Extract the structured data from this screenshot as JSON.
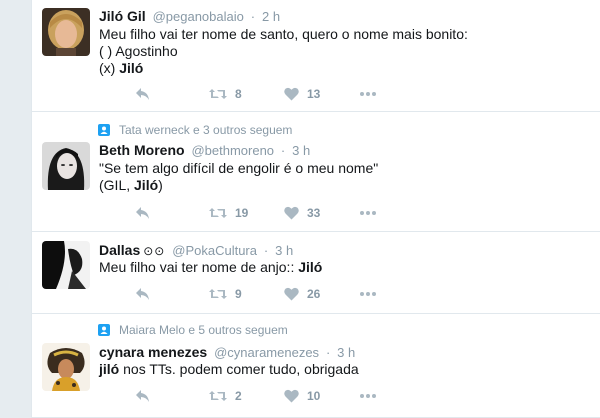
{
  "tweets": [
    {
      "context": "",
      "name": "Jiló Gil",
      "handle": "@peganobalaio",
      "time": "2 h",
      "text_parts": {
        "l1": "Meu filho vai ter nome de santo, quero o nome mais bonito:",
        "l2": "( ) Agostinho",
        "l3a": "(x) ",
        "l3b": "Jiló"
      },
      "retweets": "8",
      "likes": "13"
    },
    {
      "context": "Tata werneck e 3 outros seguem",
      "name": "Beth Moreno",
      "handle": "@bethmoreno",
      "time": "3 h",
      "text_parts": {
        "l1": "\"Se tem algo difícil de engolir é o meu nome\"",
        "l2a": "(GIL, ",
        "l2b": "Jiló",
        "l2c": ")"
      },
      "retweets": "19",
      "likes": "33"
    },
    {
      "context": "",
      "name": "Dallas",
      "badge": "⊙⊙",
      "handle": "@PokaCultura",
      "time": "3 h",
      "text_parts": {
        "l1a": "Meu filho vai ter nome de anjo:: ",
        "l1b": "Jiló"
      },
      "retweets": "9",
      "likes": "26"
    },
    {
      "context": "Maiara Melo e 5 outros seguem",
      "name": "cynara menezes",
      "handle": "@cynaramenezes",
      "time": "3 h",
      "text_parts": {
        "l1a": "jiló",
        "l1b": " nos TTs. podem comer tudo, obrigada"
      },
      "retweets": "2",
      "likes": "10"
    }
  ],
  "separator": "·",
  "colors": {
    "icon": "#aab8c2",
    "secondary_text": "#8899a6",
    "context_icon": "#1da1f2"
  }
}
